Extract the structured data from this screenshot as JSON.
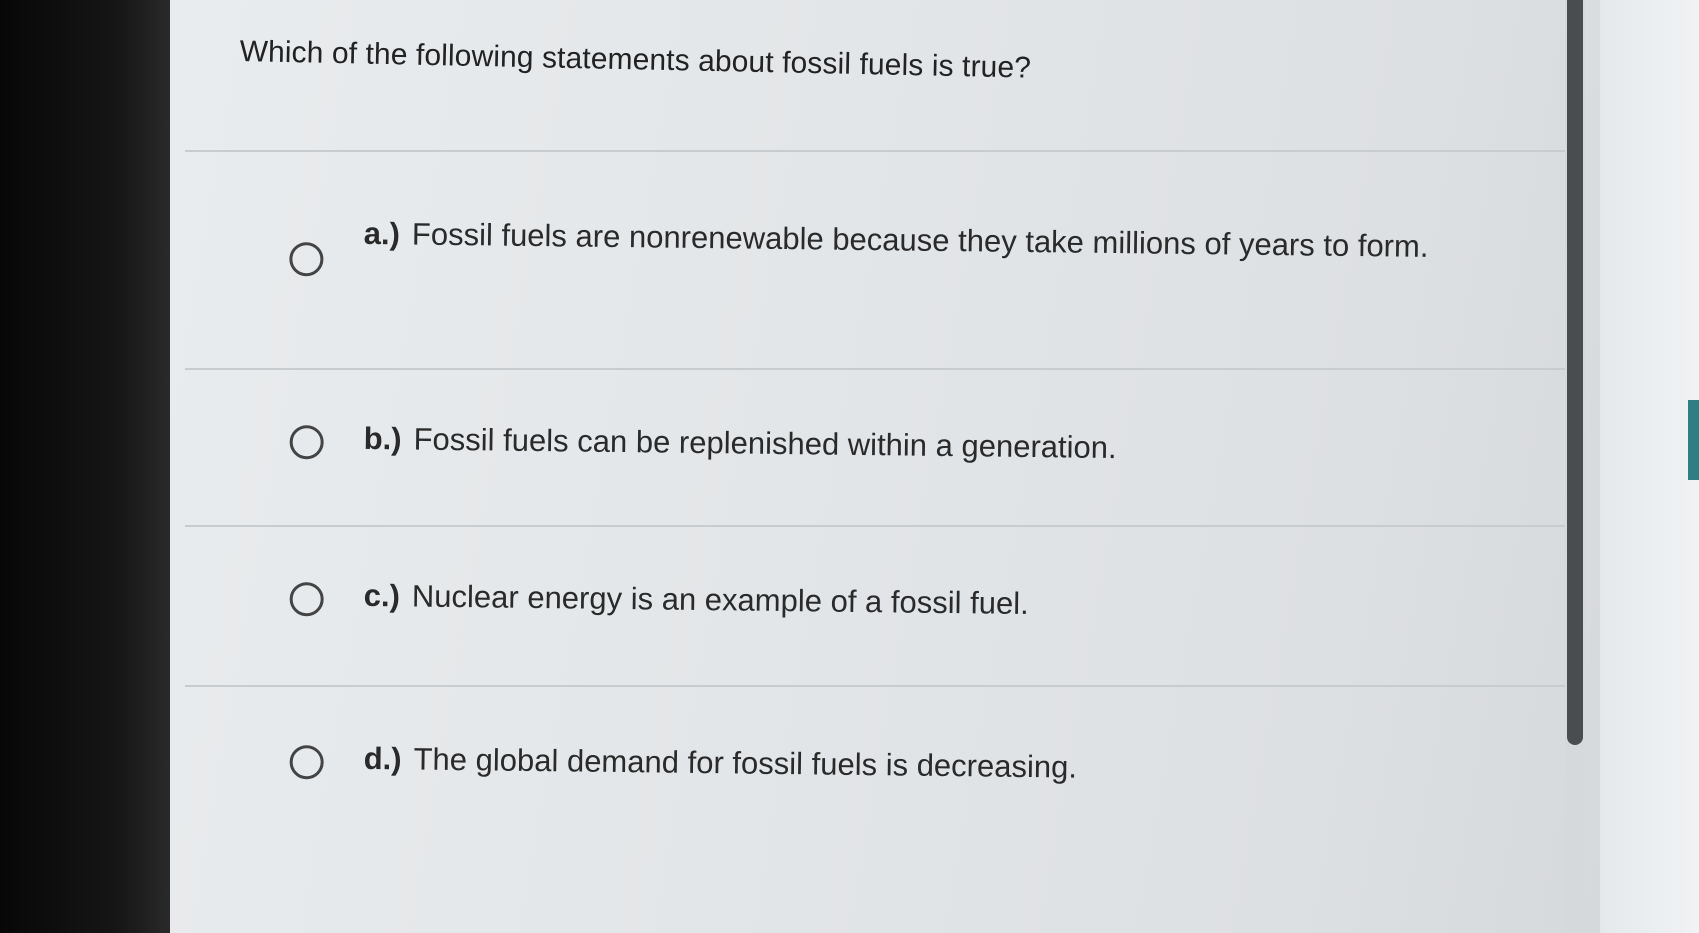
{
  "quiz": {
    "question": "Which of the following statements about fossil fuels is true?",
    "options": [
      {
        "letter": "a.)",
        "text": "Fossil fuels are nonrenewable because they take millions of years to form."
      },
      {
        "letter": "b.)",
        "text": "Fossil fuels can be replenished within a generation."
      },
      {
        "letter": "c.)",
        "text": "Nuclear energy is an example of a fossil fuel."
      },
      {
        "letter": "d.)",
        "text": "The global demand for fossil fuels is decreasing."
      }
    ]
  },
  "icons": {
    "radio": "radio-circle-icon"
  },
  "colors": {
    "background": "#e3e6e8",
    "text": "#222222",
    "divider": "#c9cccf",
    "scrollbar": "#4a4d50",
    "accent": "#2f7e83"
  }
}
